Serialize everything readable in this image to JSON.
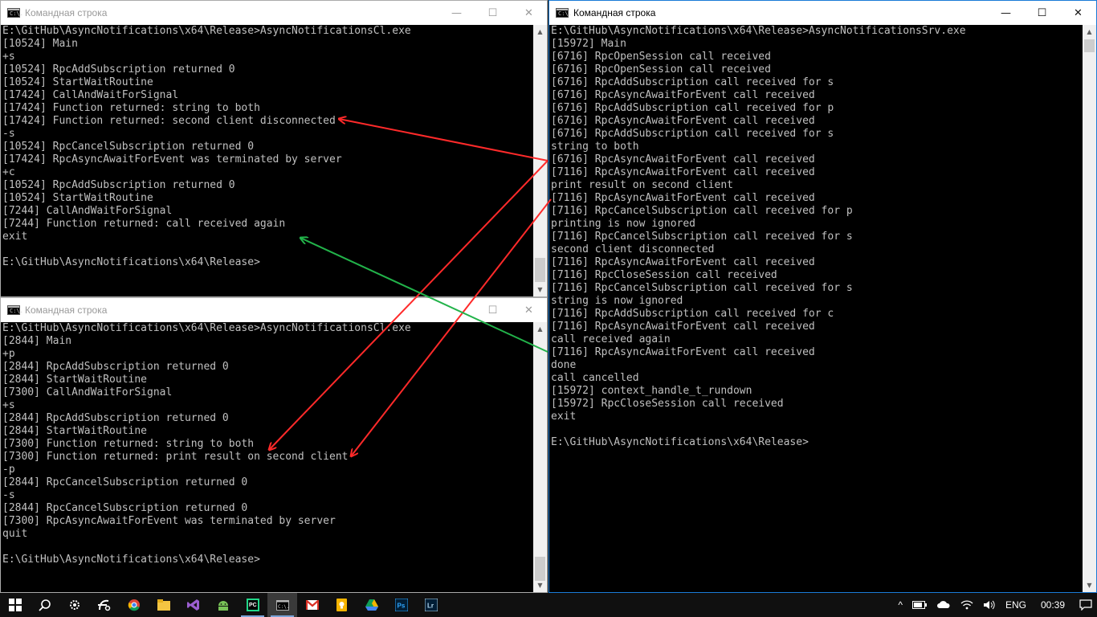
{
  "windows": {
    "client1": {
      "title": "Командная строка",
      "lines": [
        "E:\\GitHub\\AsyncNotifications\\x64\\Release>AsyncNotificationsCl.exe",
        "[10524] Main",
        "+s",
        "[10524] RpcAddSubscription returned 0",
        "[10524] StartWaitRoutine",
        "[17424] CallAndWaitForSignal",
        "[17424] Function returned: string to both",
        "[17424] Function returned: second client disconnected",
        "-s",
        "[10524] RpcCancelSubscription returned 0",
        "[17424] RpcAsyncAwaitForEvent was terminated by server",
        "+c",
        "[10524] RpcAddSubscription returned 0",
        "[10524] StartWaitRoutine",
        "[7244] CallAndWaitForSignal",
        "[7244] Function returned: call received again",
        "exit",
        "",
        "E:\\GitHub\\AsyncNotifications\\x64\\Release>"
      ]
    },
    "client2": {
      "title": "Командная строка",
      "lines": [
        "E:\\GitHub\\AsyncNotifications\\x64\\Release>AsyncNotificationsCl.exe",
        "[2844] Main",
        "+p",
        "[2844] RpcAddSubscription returned 0",
        "[2844] StartWaitRoutine",
        "[7300] CallAndWaitForSignal",
        "+s",
        "[2844] RpcAddSubscription returned 0",
        "[2844] StartWaitRoutine",
        "[7300] Function returned: string to both",
        "[7300] Function returned: print result on second client",
        "-p",
        "[2844] RpcCancelSubscription returned 0",
        "-s",
        "[2844] RpcCancelSubscription returned 0",
        "[7300] RpcAsyncAwaitForEvent was terminated by server",
        "quit",
        "",
        "E:\\GitHub\\AsyncNotifications\\x64\\Release>"
      ]
    },
    "server": {
      "title": "Командная строка",
      "lines": [
        "E:\\GitHub\\AsyncNotifications\\x64\\Release>AsyncNotificationsSrv.exe",
        "[15972] Main",
        "[6716] RpcOpenSession call received",
        "[6716] RpcOpenSession call received",
        "[6716] RpcAddSubscription call received for s",
        "[6716] RpcAsyncAwaitForEvent call received",
        "[6716] RpcAddSubscription call received for p",
        "[6716] RpcAsyncAwaitForEvent call received",
        "[6716] RpcAddSubscription call received for s",
        "string to both",
        "[6716] RpcAsyncAwaitForEvent call received",
        "[7116] RpcAsyncAwaitForEvent call received",
        "print result on second client",
        "[7116] RpcAsyncAwaitForEvent call received",
        "[7116] RpcCancelSubscription call received for p",
        "printing is now ignored",
        "[7116] RpcCancelSubscription call received for s",
        "second client disconnected",
        "[7116] RpcAsyncAwaitForEvent call received",
        "[7116] RpcCloseSession call received",
        "[7116] RpcCancelSubscription call received for s",
        "string is now ignored",
        "[7116] RpcAddSubscription call received for c",
        "[7116] RpcAsyncAwaitForEvent call received",
        "call received again",
        "[7116] RpcAsyncAwaitForEvent call received",
        "done",
        "call cancelled",
        "[15972] context_handle_t_rundown",
        "[15972] RpcCloseSession call received",
        "exit",
        "",
        "E:\\GitHub\\AsyncNotifications\\x64\\Release>"
      ]
    }
  },
  "window_controls": {
    "minimize": "—",
    "maximize": "☐",
    "close": "✕"
  },
  "app_icon_text": "C:\\.",
  "annotation_colors": {
    "red": "#ff2a2a",
    "green": "#22b34a"
  },
  "taskbar": {
    "items": [
      {
        "name": "start-button",
        "icon": "windows-logo"
      },
      {
        "name": "search-button",
        "icon": "search"
      },
      {
        "name": "settings-button",
        "icon": "gear"
      },
      {
        "name": "app-fl-button",
        "icon": "fl"
      },
      {
        "name": "chrome-button",
        "icon": "chrome"
      },
      {
        "name": "explorer-button",
        "icon": "folder"
      },
      {
        "name": "visualstudio-button",
        "icon": "visual-studio"
      },
      {
        "name": "android-button",
        "icon": "android"
      },
      {
        "name": "pycharm-button",
        "icon": "pycharm",
        "label": "PC"
      },
      {
        "name": "cmd-button",
        "icon": "cmd"
      },
      {
        "name": "gmail-button",
        "icon": "gmail"
      },
      {
        "name": "keep-button",
        "icon": "keep"
      },
      {
        "name": "drive-button",
        "icon": "drive"
      },
      {
        "name": "photoshop-button",
        "icon": "photoshop",
        "label": "Ps"
      },
      {
        "name": "lightroom-button",
        "icon": "lightroom",
        "label": "Lr"
      }
    ],
    "tray": {
      "chevron": "^",
      "language": "ENG",
      "time": "00:39"
    }
  }
}
